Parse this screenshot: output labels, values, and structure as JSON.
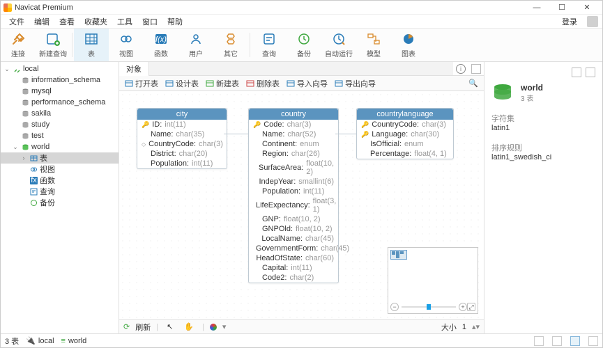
{
  "app": {
    "title": "Navicat Premium"
  },
  "window_controls": {
    "min": "—",
    "max": "☐",
    "close": "✕"
  },
  "menu": {
    "items": [
      "文件",
      "编辑",
      "查看",
      "收藏夹",
      "工具",
      "窗口",
      "帮助"
    ],
    "right": "登录"
  },
  "toolbar": [
    {
      "label": "连接",
      "icon": "plug-icon"
    },
    {
      "label": "新建查询",
      "icon": "new-query-icon"
    },
    {
      "label": "表",
      "icon": "table-icon",
      "active": true
    },
    {
      "label": "视图",
      "icon": "view-icon"
    },
    {
      "label": "函数",
      "icon": "fx-icon"
    },
    {
      "label": "用户",
      "icon": "user-icon"
    },
    {
      "label": "其它",
      "icon": "misc-icon"
    },
    {
      "label": "查询",
      "icon": "query-icon"
    },
    {
      "label": "备份",
      "icon": "backup-icon"
    },
    {
      "label": "自动运行",
      "icon": "schedule-icon"
    },
    {
      "label": "模型",
      "icon": "model-icon"
    },
    {
      "label": "图表",
      "icon": "chart-icon"
    }
  ],
  "tree": {
    "root": "local",
    "databases": [
      "information_schema",
      "mysql",
      "performance_schema",
      "sakila",
      "study",
      "test"
    ],
    "open_db": "world",
    "open_db_children": [
      "表",
      "视图",
      "函数",
      "查询",
      "备份"
    ],
    "selected": "表"
  },
  "obj_tab": "对象",
  "obj_tools": [
    "打开表",
    "设计表",
    "新建表",
    "删除表",
    "导入向导",
    "导出向导"
  ],
  "entities": {
    "city": {
      "title": "city",
      "fields": [
        {
          "key": true,
          "name": "ID",
          "type": "int(11)"
        },
        {
          "name": "Name",
          "type": "char(35)"
        },
        {
          "diamond": true,
          "name": "CountryCode",
          "type": "char(3)"
        },
        {
          "name": "District",
          "type": "char(20)"
        },
        {
          "name": "Population",
          "type": "int(11)"
        }
      ]
    },
    "country": {
      "title": "country",
      "fields": [
        {
          "key": true,
          "name": "Code",
          "type": "char(3)"
        },
        {
          "name": "Name",
          "type": "char(52)"
        },
        {
          "name": "Continent",
          "type": "enum"
        },
        {
          "name": "Region",
          "type": "char(26)"
        },
        {
          "name": "SurfaceArea",
          "type": "float(10, 2)"
        },
        {
          "name": "IndepYear",
          "type": "smallint(6)"
        },
        {
          "name": "Population",
          "type": "int(11)"
        },
        {
          "name": "LifeExpectancy",
          "type": "float(3, 1)"
        },
        {
          "name": "GNP",
          "type": "float(10, 2)"
        },
        {
          "name": "GNPOld",
          "type": "float(10, 2)"
        },
        {
          "name": "LocalName",
          "type": "char(45)"
        },
        {
          "name": "GovernmentForm",
          "type": "char(45)"
        },
        {
          "name": "HeadOfState",
          "type": "char(60)"
        },
        {
          "name": "Capital",
          "type": "int(11)"
        },
        {
          "name": "Code2",
          "type": "char(2)"
        }
      ]
    },
    "countrylanguage": {
      "title": "countrylanguage",
      "fields": [
        {
          "key": true,
          "name": "CountryCode",
          "type": "char(3)"
        },
        {
          "key": true,
          "name": "Language",
          "type": "char(30)"
        },
        {
          "name": "IsOfficial",
          "type": "enum"
        },
        {
          "name": "Percentage",
          "type": "float(4, 1)"
        }
      ]
    }
  },
  "canvas_footer": {
    "refresh": "刷新",
    "size_label": "大小",
    "size_value": "1"
  },
  "rightpane": {
    "title": "world",
    "subtitle": "3 表",
    "charset_label": "字符集",
    "charset_value": "latin1",
    "collation_label": "排序规则",
    "collation_value": "latin1_swedish_ci"
  },
  "status": {
    "left": "3 表",
    "conn": "local",
    "db": "world"
  },
  "colors": {
    "header": "#5b94bf",
    "accent": "#1aa0e6",
    "green": "#3fa83f"
  }
}
